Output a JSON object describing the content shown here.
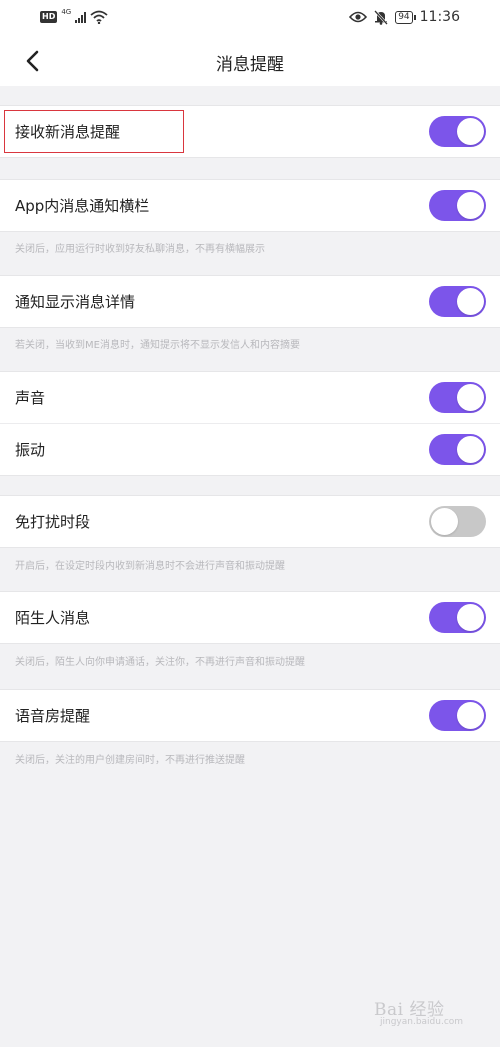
{
  "status_bar": {
    "hd": "HD",
    "signal": "4G",
    "battery": "94",
    "time": "11:36"
  },
  "navbar": {
    "title": "消息提醒"
  },
  "settings": [
    {
      "label": "接收新消息提醒",
      "on": true
    },
    {
      "label": "App内消息通知横栏",
      "on": true,
      "hint": "关闭后，应用运行时收到好友私聊消息，不再有横幅展示"
    },
    {
      "label": "通知显示消息详情",
      "on": true,
      "hint": "若关闭，当收到ME消息时，通知提示将不显示发信人和内容摘要"
    },
    {
      "label": "声音",
      "on": true
    },
    {
      "label": "振动",
      "on": true
    },
    {
      "label": "免打扰时段",
      "on": false,
      "hint": "开启后，在设定时段内收到新消息时不会进行声音和振动提醒"
    },
    {
      "label": "陌生人消息",
      "on": true,
      "hint": "关闭后，陌生人向你申请通话，关注你，不再进行声音和振动提醒"
    },
    {
      "label": "语音房提醒",
      "on": true,
      "hint": "关闭后，关注的用户创建房间时，不再进行推送提醒"
    }
  ],
  "watermark": {
    "text": "Bai 经验",
    "sub": "jingyan.baidu.com"
  },
  "colors": {
    "toggle_on": "#7c55ea",
    "toggle_off": "#c8c8c8",
    "highlight": "#d9363e"
  }
}
